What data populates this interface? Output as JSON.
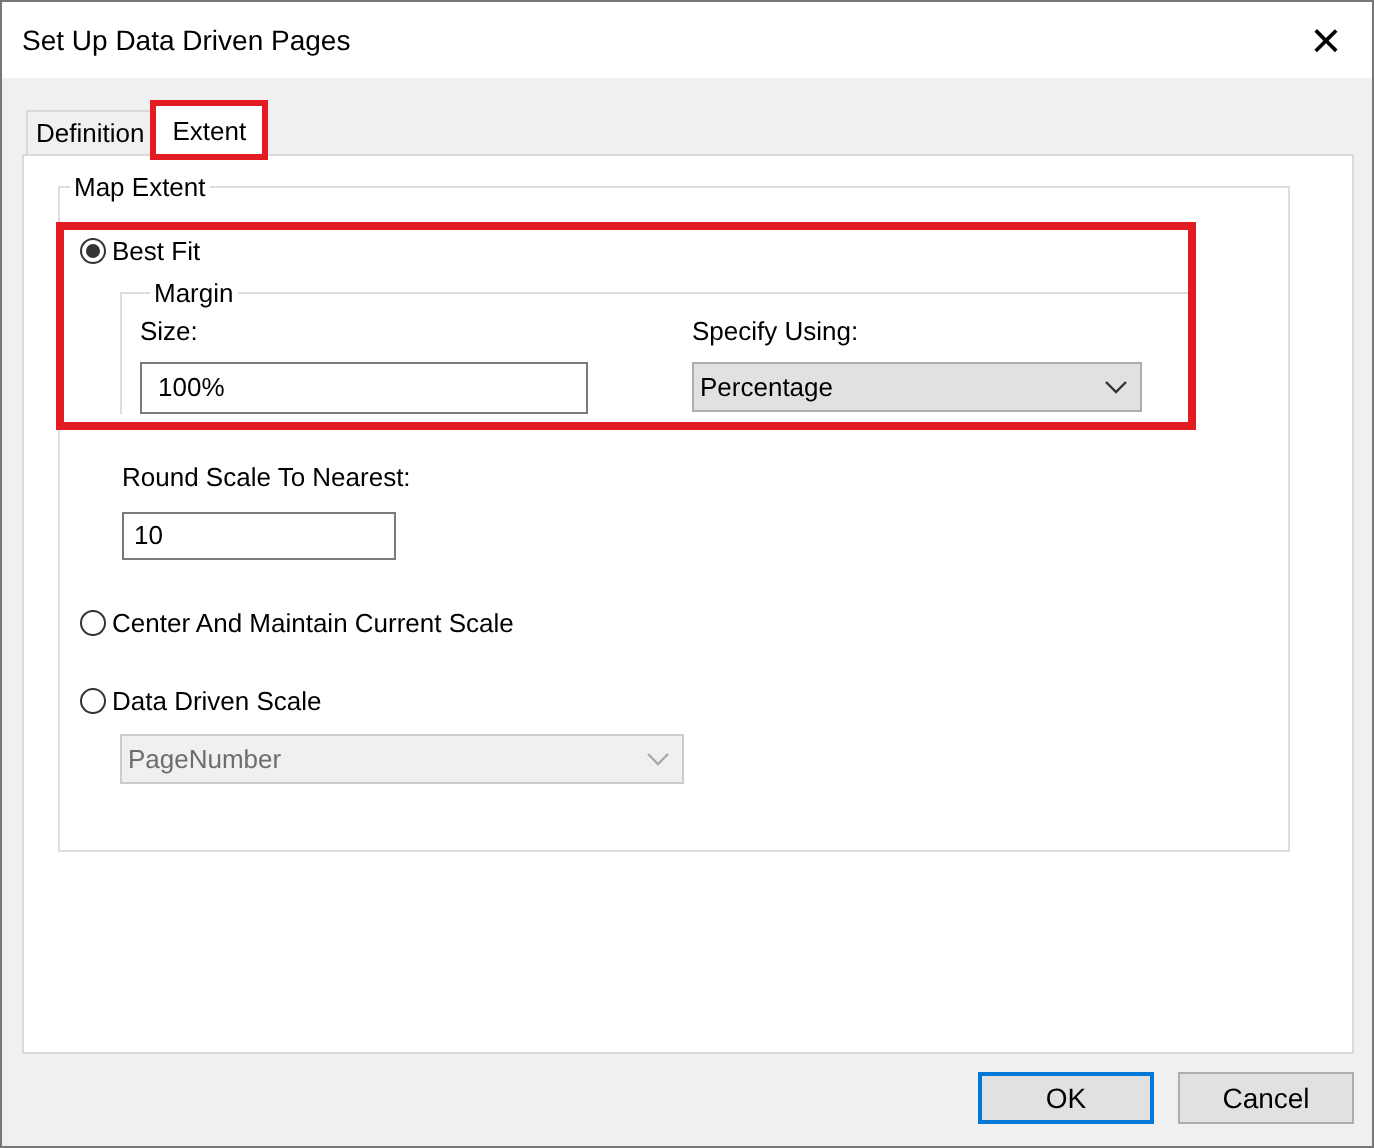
{
  "window": {
    "title": "Set Up Data Driven Pages",
    "close": "×"
  },
  "tabs": [
    {
      "label": "Definition",
      "selected": false,
      "annotated": false
    },
    {
      "label": "Extent",
      "selected": true,
      "annotated": true
    }
  ],
  "map_extent": {
    "legend": "Map Extent",
    "options": [
      {
        "label": "Best Fit",
        "selected": true,
        "annotated": true,
        "kind": "best_fit",
        "margin": {
          "legend": "Margin",
          "size_label": "Size:",
          "size_value": "100%",
          "specify_label": "Specify Using:",
          "specify_value": "Percentage"
        },
        "round_label": "Round Scale To Nearest:",
        "round_value": "10"
      },
      {
        "label": "Center And Maintain Current Scale",
        "selected": false,
        "kind": "plain"
      },
      {
        "label": "Data Driven Scale",
        "selected": false,
        "kind": "field",
        "field_value": "PageNumber",
        "disabled": true
      }
    ]
  },
  "buttons": [
    {
      "label": "OK",
      "default": true
    },
    {
      "label": "Cancel",
      "default": false
    }
  ]
}
